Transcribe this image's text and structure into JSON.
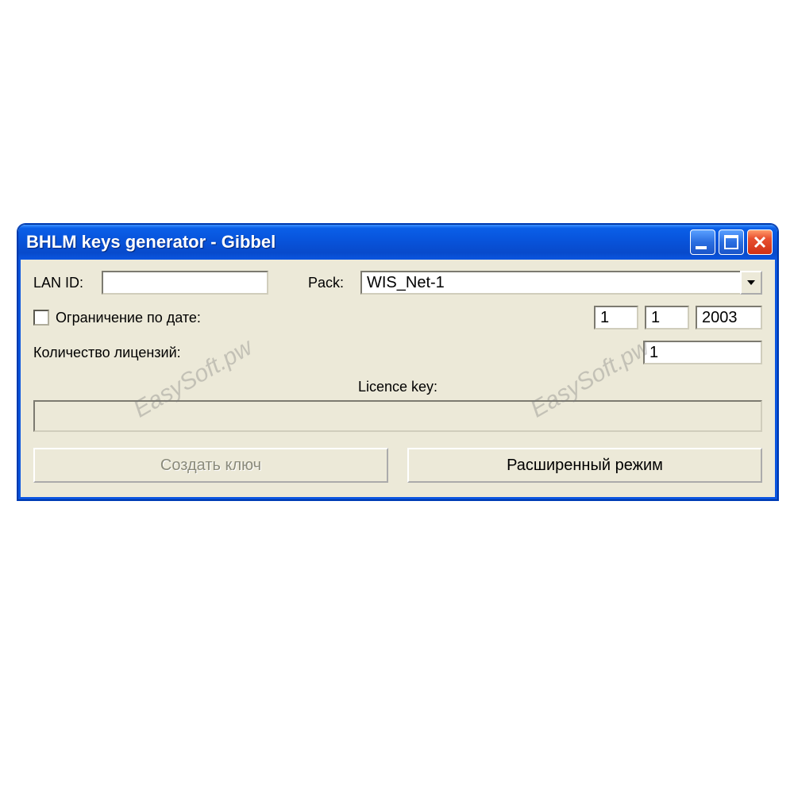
{
  "window": {
    "title": "BHLM keys generator - Gibbel"
  },
  "labels": {
    "lan_id": "LAN ID:",
    "pack": "Pack:",
    "date_limit": "Ограничение по дате:",
    "license_count": "Количество лицензий:",
    "license_key": "Licence key:"
  },
  "fields": {
    "lan_id": "",
    "pack_selected": "WIS_Net-1",
    "date_day": "1",
    "date_month": "1",
    "date_year": "2003",
    "license_count": "1",
    "license_key_value": ""
  },
  "buttons": {
    "create_key": "Создать ключ",
    "advanced_mode": "Расширенный режим"
  },
  "watermark": "EasySoft.pw"
}
